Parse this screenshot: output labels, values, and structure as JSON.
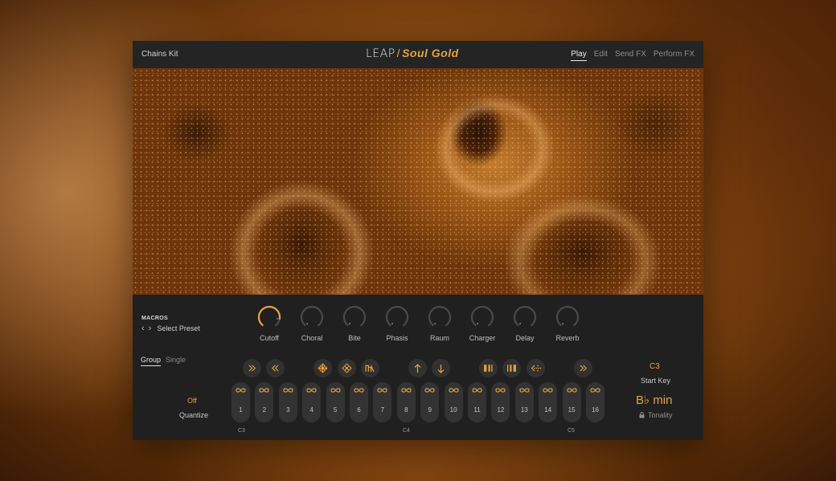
{
  "header": {
    "kit_name": "Chains Kit",
    "logo_part1": "LEAP",
    "logo_separator": "/",
    "logo_part2": "Soul Gold",
    "nav": [
      "Play",
      "Edit",
      "Send FX",
      "Perform FX"
    ],
    "active_nav": "Play"
  },
  "macros": {
    "title": "MACROS",
    "preset_label": "Select Preset",
    "knobs": [
      {
        "label": "Cutoff",
        "value": 0.85,
        "active": true
      },
      {
        "label": "Choral",
        "value": 0.0,
        "active": false
      },
      {
        "label": "Bite",
        "value": 0.0,
        "active": false
      },
      {
        "label": "Phasis",
        "value": 0.0,
        "active": false
      },
      {
        "label": "Raum",
        "value": 0.0,
        "active": false
      },
      {
        "label": "Charger",
        "value": 0.0,
        "active": false
      },
      {
        "label": "Delay",
        "value": 0.0,
        "active": false
      },
      {
        "label": "Reverb",
        "value": 0.0,
        "active": false
      }
    ]
  },
  "sequencer": {
    "tabs": [
      "Group",
      "Single"
    ],
    "active_tab": "Group",
    "pattern_buttons": [
      "double-chevron-right-icon",
      "double-chevron-left-icon",
      "diamond-grid-icon",
      "diamond-grid-alt-icon",
      "waveform-icon",
      "arrow-up-icon",
      "arrow-down-icon",
      "bars-split-icon",
      "bars-split-alt-icon",
      "dotted-arrow-left-icon",
      "double-chevron-right-icon"
    ],
    "quantize_value": "Off",
    "quantize_label": "Quantize",
    "steps": [
      "1",
      "2",
      "3",
      "4",
      "5",
      "6",
      "7",
      "8",
      "9",
      "10",
      "11",
      "12",
      "13",
      "14",
      "15",
      "16"
    ],
    "note_labels": [
      "C3",
      "C4",
      "C5"
    ]
  },
  "key": {
    "start_key_value": "C3",
    "start_key_label": "Start Key",
    "tonality_value": "B♭ min",
    "tonality_label": "Tonality"
  },
  "colors": {
    "accent": "#e8a33d",
    "panel": "#202020",
    "control": "#333333"
  }
}
